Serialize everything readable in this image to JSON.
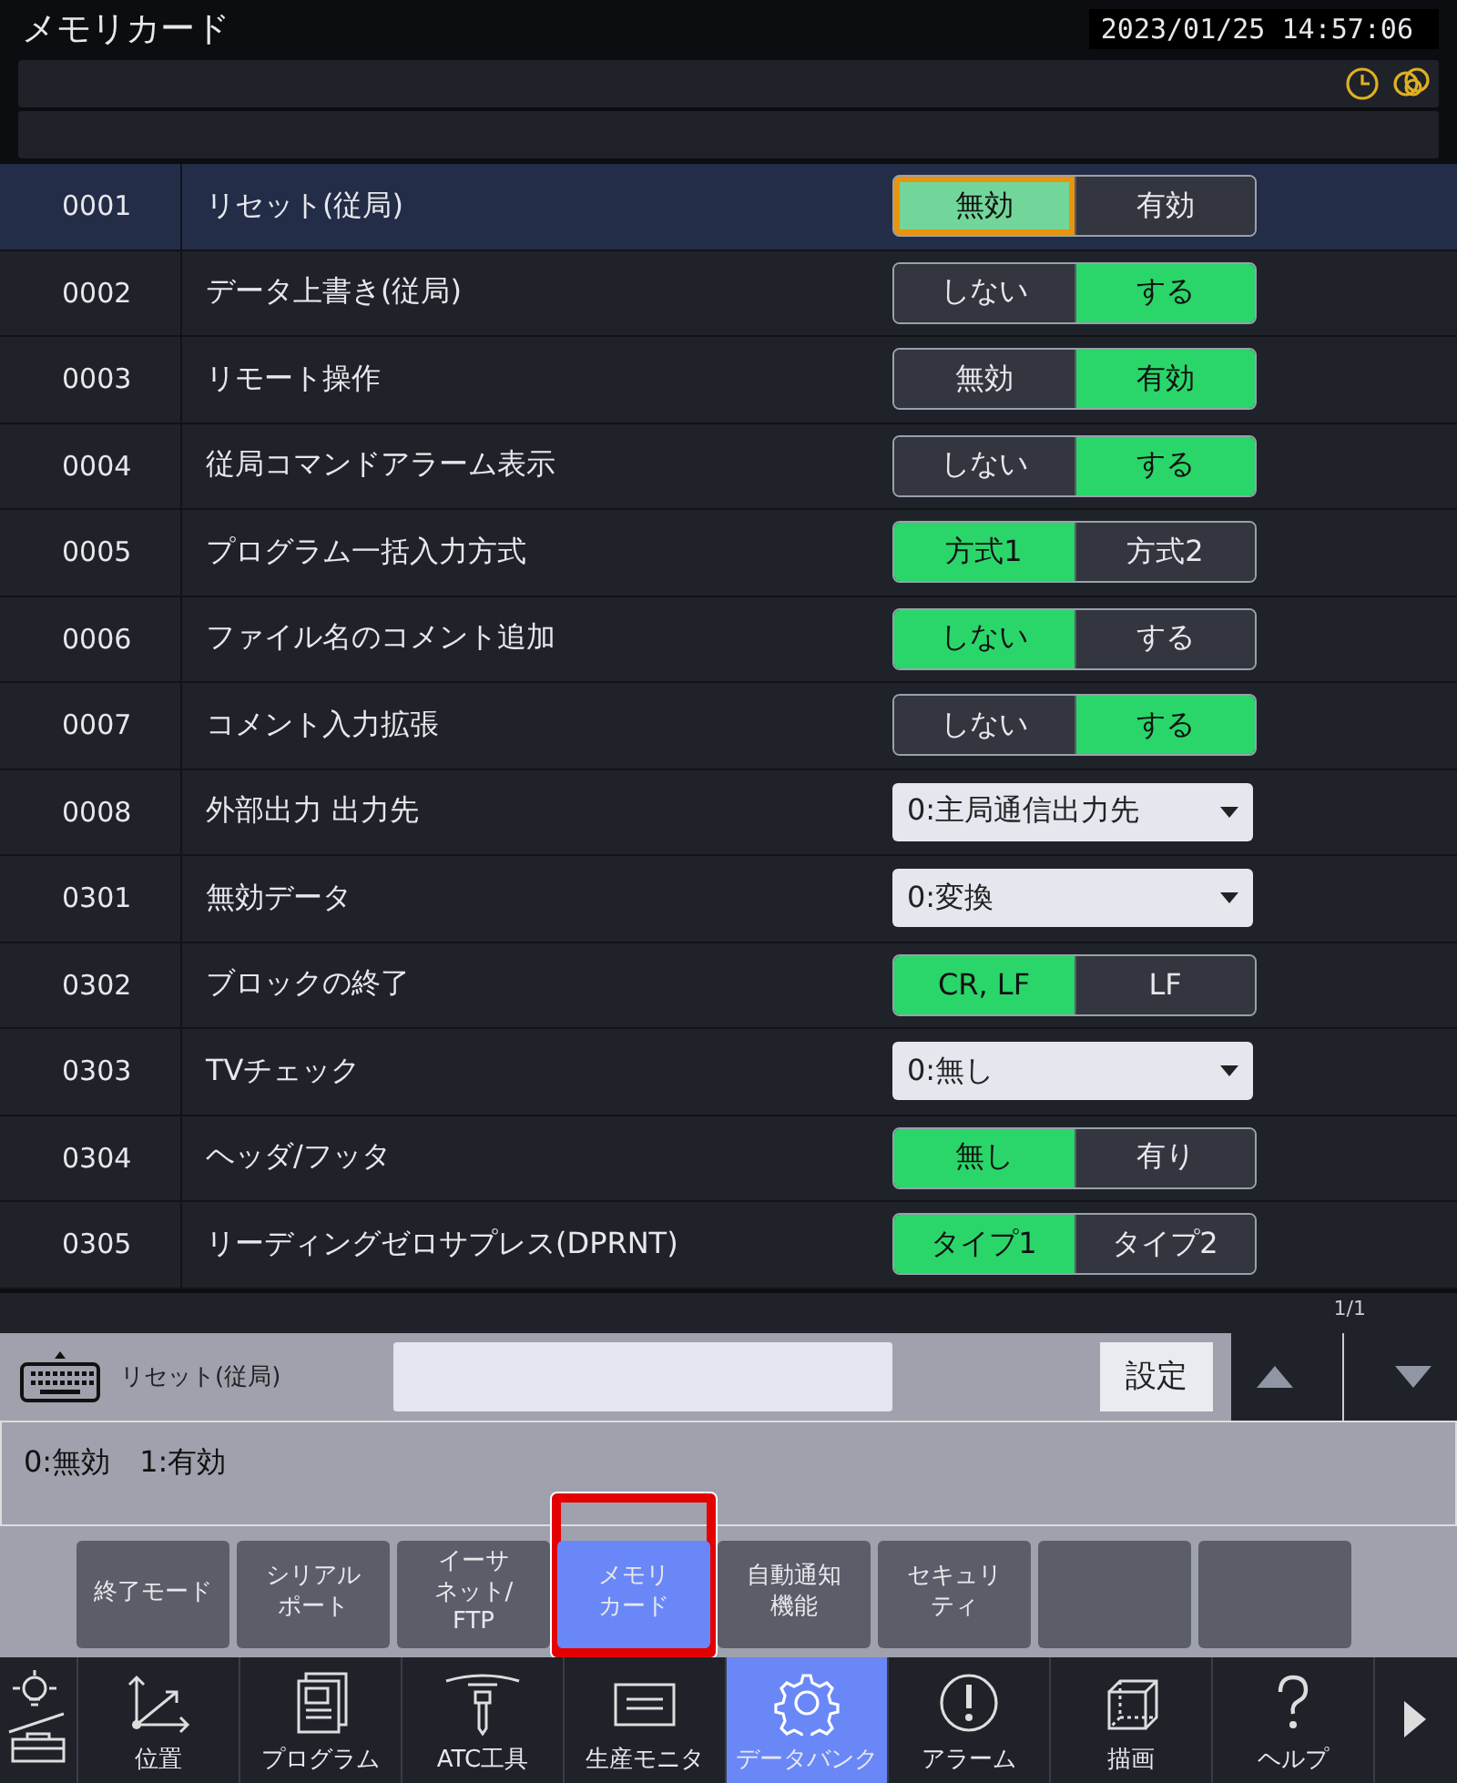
{
  "title": "メモリカード",
  "datetime": "2023/01/25 14:57:06",
  "rows": [
    {
      "no": "0001",
      "label": "リセット(従局)",
      "kind": "toggle",
      "selected": true,
      "options": [
        {
          "text": "無効",
          "selected": true
        },
        {
          "text": "有効",
          "selected": false
        }
      ]
    },
    {
      "no": "0002",
      "label": "データ上書き(従局)",
      "kind": "toggle",
      "selected": false,
      "options": [
        {
          "text": "しない",
          "selected": false
        },
        {
          "text": "する",
          "selected": true
        }
      ]
    },
    {
      "no": "0003",
      "label": "リモート操作",
      "kind": "toggle",
      "selected": false,
      "options": [
        {
          "text": "無効",
          "selected": false
        },
        {
          "text": "有効",
          "selected": true
        }
      ]
    },
    {
      "no": "0004",
      "label": "従局コマンドアラーム表示",
      "kind": "toggle",
      "selected": false,
      "options": [
        {
          "text": "しない",
          "selected": false
        },
        {
          "text": "する",
          "selected": true
        }
      ]
    },
    {
      "no": "0005",
      "label": "プログラム一括入力方式",
      "kind": "toggle",
      "selected": false,
      "options": [
        {
          "text": "方式1",
          "selected": true
        },
        {
          "text": "方式2",
          "selected": false
        }
      ]
    },
    {
      "no": "0006",
      "label": "ファイル名のコメント追加",
      "kind": "toggle",
      "selected": false,
      "options": [
        {
          "text": "しない",
          "selected": true
        },
        {
          "text": "する",
          "selected": false
        }
      ]
    },
    {
      "no": "0007",
      "label": "コメント入力拡張",
      "kind": "toggle",
      "selected": false,
      "options": [
        {
          "text": "しない",
          "selected": false
        },
        {
          "text": "する",
          "selected": true
        }
      ]
    },
    {
      "no": "0008",
      "label": "外部出力 出力先",
      "kind": "dropdown",
      "selected": false,
      "value": "0:主局通信出力先"
    },
    {
      "no": "0301",
      "label": "無効データ",
      "kind": "dropdown",
      "selected": false,
      "value": "0:変換"
    },
    {
      "no": "0302",
      "label": "ブロックの終了",
      "kind": "toggle",
      "selected": false,
      "options": [
        {
          "text": "CR, LF",
          "selected": true
        },
        {
          "text": "LF",
          "selected": false
        }
      ]
    },
    {
      "no": "0303",
      "label": "TVチェック",
      "kind": "dropdown",
      "selected": false,
      "value": "0:無し"
    },
    {
      "no": "0304",
      "label": "ヘッダ/フッタ",
      "kind": "toggle",
      "selected": false,
      "options": [
        {
          "text": "無し",
          "selected": true
        },
        {
          "text": "有り",
          "selected": false
        }
      ]
    },
    {
      "no": "0305",
      "label": "リーディングゼロサプレス(DPRNT)",
      "kind": "toggle",
      "selected": false,
      "options": [
        {
          "text": "タイプ1",
          "selected": true
        },
        {
          "text": "タイプ2",
          "selected": false
        }
      ]
    }
  ],
  "page": "1/1",
  "input": {
    "label": "リセット(従局)",
    "button": "設定"
  },
  "help": "0:無効　1:有効",
  "functions": [
    {
      "lines": [
        "終了モード"
      ],
      "selected": false
    },
    {
      "lines": [
        "シリアル",
        "ポート"
      ],
      "selected": false
    },
    {
      "lines": [
        "イーサ",
        "ネット/",
        "FTP"
      ],
      "selected": false
    },
    {
      "lines": [
        "メモリ",
        "カード"
      ],
      "selected": true
    },
    {
      "lines": [
        "自動通知",
        "機能"
      ],
      "selected": false
    },
    {
      "lines": [
        "セキュリ",
        "ティ"
      ],
      "selected": false
    },
    {
      "selected": false
    },
    {
      "selected": false
    }
  ],
  "nav": [
    {
      "kind": "tool",
      "selected": false
    },
    {
      "kind": "position",
      "text": "位置",
      "selected": false
    },
    {
      "kind": "program",
      "text": "プログラム",
      "selected": false
    },
    {
      "kind": "atc",
      "text": "ATC工具",
      "selected": false
    },
    {
      "kind": "monitor",
      "text": "生産モニタ",
      "selected": false
    },
    {
      "kind": "gear",
      "text": "データバンク",
      "selected": true
    },
    {
      "kind": "alarm",
      "text": "アラーム",
      "selected": false
    },
    {
      "kind": "cube",
      "text": "描画",
      "selected": false
    },
    {
      "kind": "help",
      "text": "ヘルプ",
      "selected": false
    }
  ]
}
